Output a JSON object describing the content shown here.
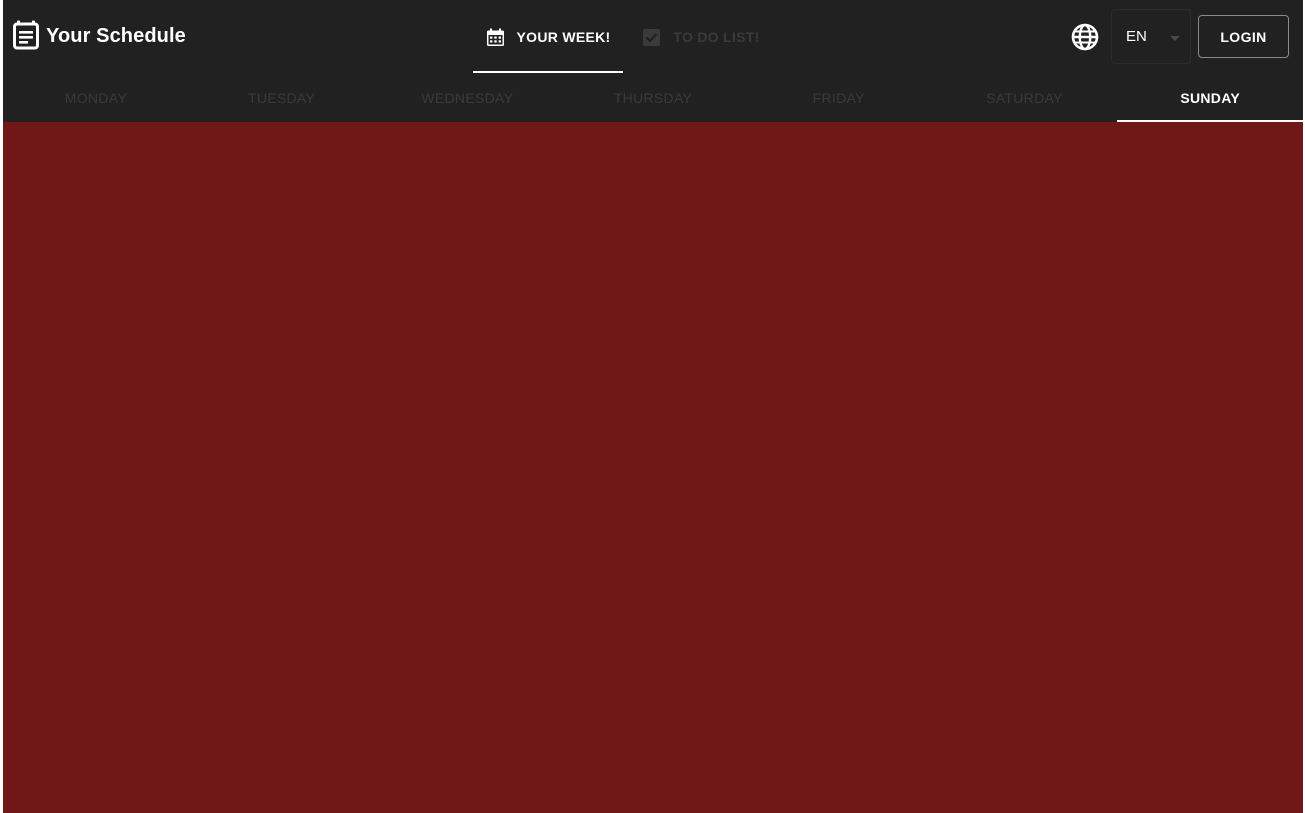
{
  "app": {
    "title": "Your Schedule",
    "icon": "schedule-icon"
  },
  "nav": {
    "tabs": [
      {
        "label": "YOUR WEEK!",
        "icon": "calendar-icon",
        "active": true
      },
      {
        "label": "TO DO LIST!",
        "icon": "checkbox-icon",
        "active": false
      }
    ]
  },
  "language": {
    "icon": "globe-icon",
    "selected": "EN"
  },
  "login": {
    "label": "LOGIN"
  },
  "days": [
    {
      "label": "MONDAY",
      "active": false
    },
    {
      "label": "TUESDAY",
      "active": false
    },
    {
      "label": "WEDNESDAY",
      "active": false
    },
    {
      "label": "THURSDAY",
      "active": false
    },
    {
      "label": "FRIDAY",
      "active": false
    },
    {
      "label": "SATURDAY",
      "active": false
    },
    {
      "label": "SUNDAY",
      "active": true
    }
  ],
  "colors": {
    "appbar": "#212121",
    "content_background": "#701818",
    "active_text": "#ffffff",
    "inactive_text": "#3a3a3a"
  }
}
